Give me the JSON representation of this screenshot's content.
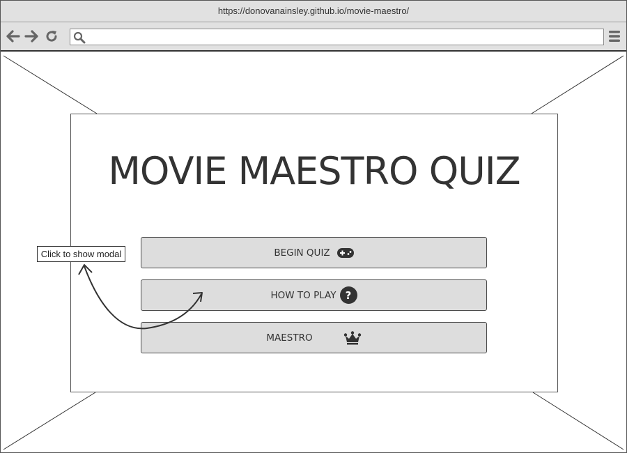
{
  "browser": {
    "url": "https://donovanainsley.github.io/movie-maestro/",
    "address_value": "",
    "nav_icons": [
      "back-arrow-icon",
      "forward-arrow-icon",
      "reload-icon",
      "search-icon",
      "hamburger-menu-icon"
    ]
  },
  "modal": {
    "title": "MOVIE MAESTRO QUIZ",
    "buttons": [
      {
        "label": "BEGIN QUIZ",
        "icon": "gamepad-icon"
      },
      {
        "label": "HOW TO PLAY",
        "icon": "question-circle-icon"
      },
      {
        "label": "MAESTRO",
        "icon": "crown-icon"
      }
    ]
  },
  "annotation": {
    "callout_text": "Click to show modal",
    "icon": "curved-arrow-icon"
  },
  "colors": {
    "chrome": "#e1e1e1",
    "button_fill": "#dddddd",
    "dark": "#333333"
  }
}
